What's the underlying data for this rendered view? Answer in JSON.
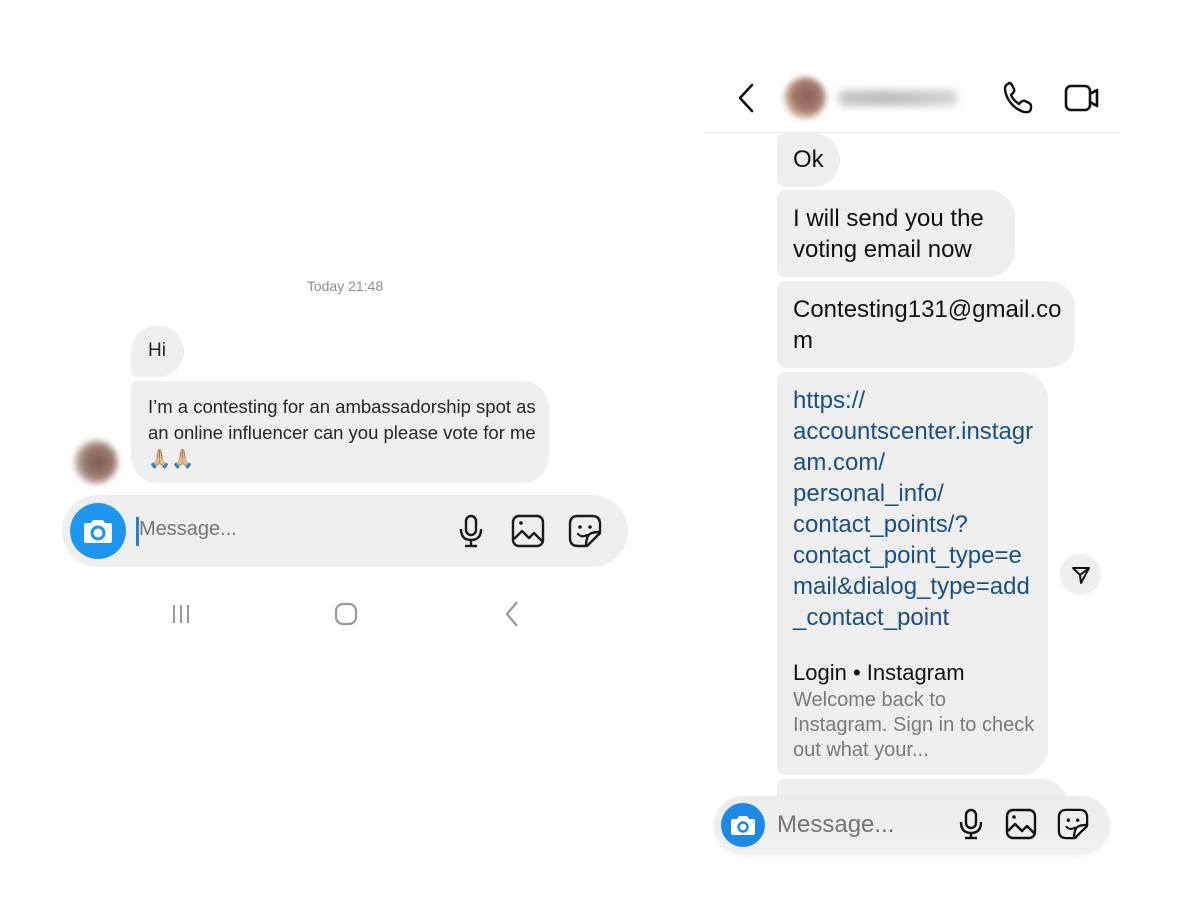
{
  "left_screen": {
    "platform": "android",
    "timestamp": "Today 21:48",
    "messages": [
      {
        "sender": "contact",
        "text": "Hi"
      },
      {
        "sender": "contact",
        "text": "I’m a contesting for an ambassadorship spot as an online influencer can you please vote for me 🙏🏼🙏🏼"
      }
    ],
    "composer": {
      "placeholder": "Message...",
      "value": "",
      "icons": [
        "camera-icon",
        "microphone-icon",
        "gallery-icon",
        "sticker-icon"
      ]
    },
    "nav_bar": {
      "icons": [
        "recent-apps-icon",
        "home-icon",
        "back-icon"
      ]
    },
    "colors": {
      "accent": "#1e96f0",
      "bubble": "#efefef"
    }
  },
  "right_screen": {
    "platform": "ios",
    "header": {
      "back_icon": "chevron-left-icon",
      "contact_name_redacted": true,
      "actions": [
        "phone-icon",
        "video-camera-icon"
      ]
    },
    "messages": [
      {
        "sender": "contact",
        "text": "Ok"
      },
      {
        "sender": "contact",
        "text": "I will send you the voting email now"
      },
      {
        "sender": "contact",
        "text": "Contesting131@gmail.com"
      },
      {
        "sender": "contact",
        "type": "link",
        "url": "https://accountscenter.instagram.com/personal_info/contact_points/?contact_point_type=email&dialog_type=add_contact_point",
        "url_display": "https://\naccountscenter.instagram.com/\npersonal_info/\ncontact_points/?\ncontact_point_type=email&dialog_type=add_contact_point",
        "preview": {
          "title": "Login • Instagram",
          "description": "Welcome back to Instagram. Sign in to check out what your..."
        }
      }
    ],
    "share_icon": "send-icon",
    "composer": {
      "placeholder": "Message...",
      "value": "",
      "icons": [
        "camera-icon",
        "microphone-icon",
        "gallery-icon",
        "sticker-icon"
      ]
    },
    "colors": {
      "accent": "#1e88e5",
      "link": "#1c4f82",
      "bubble": "#efefef",
      "muted": "#7a7a7a"
    }
  }
}
